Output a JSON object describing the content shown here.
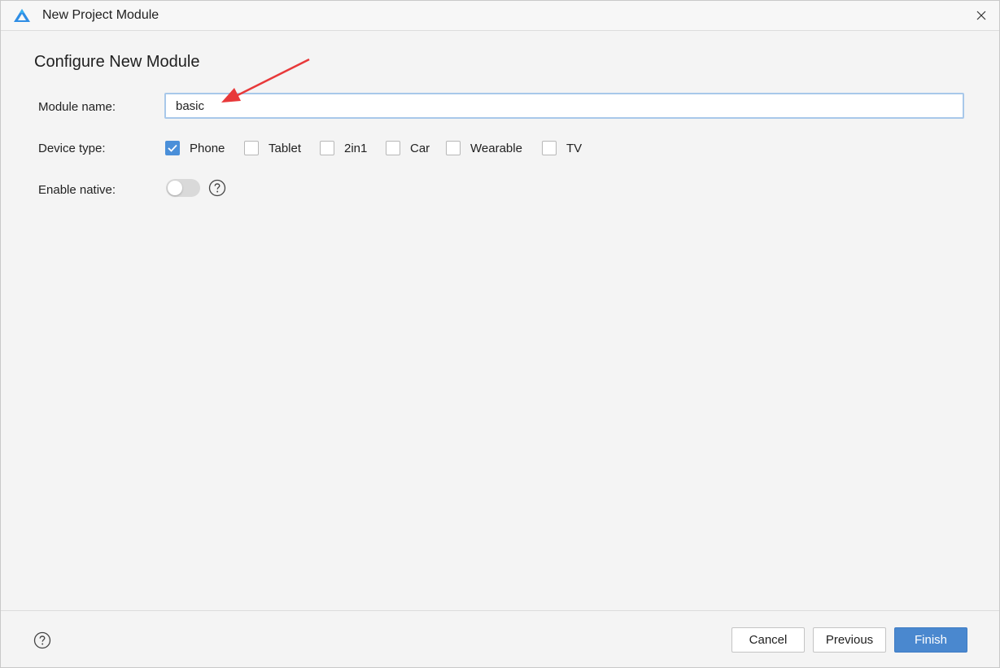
{
  "window": {
    "title": "New Project Module"
  },
  "heading": "Configure New Module",
  "form": {
    "module_name_label": "Module name:",
    "module_name_value": "basic",
    "device_type_label": "Device type:",
    "devices": [
      {
        "label": "Phone",
        "checked": true
      },
      {
        "label": "Tablet",
        "checked": false
      },
      {
        "label": "2in1",
        "checked": false
      },
      {
        "label": "Car",
        "checked": false
      },
      {
        "label": "Wearable",
        "checked": false
      },
      {
        "label": "TV",
        "checked": false
      }
    ],
    "enable_native_label": "Enable native:",
    "enable_native_on": false
  },
  "footer": {
    "cancel_label": "Cancel",
    "previous_label": "Previous",
    "finish_label": "Finish"
  },
  "colors": {
    "accent": "#4a88cf",
    "annotation_arrow": "#e8393a"
  },
  "icons": {
    "app": "deveco-logo-icon",
    "close": "close-icon",
    "help": "help-icon",
    "checkmark": "checkmark-icon"
  }
}
